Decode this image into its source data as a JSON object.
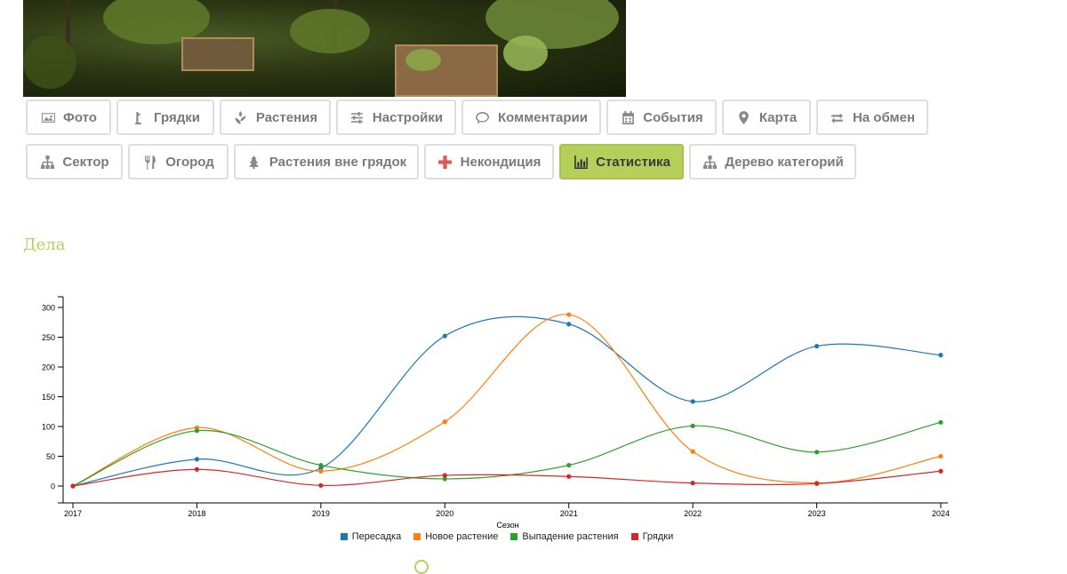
{
  "photo": {
    "alt": "garden beds photo"
  },
  "nav": {
    "row1": [
      {
        "label": "Фото",
        "icon": "image-icon"
      },
      {
        "label": "Грядки",
        "icon": "flag-icon"
      },
      {
        "label": "Растения",
        "icon": "plant-icon"
      },
      {
        "label": "Настройки",
        "icon": "sliders-icon"
      },
      {
        "label": "Комментарии",
        "icon": "comment-icon"
      },
      {
        "label": "События",
        "icon": "calendar-icon"
      },
      {
        "label": "Карта",
        "icon": "map-marker-icon"
      },
      {
        "label": "На обмен",
        "icon": "exchange-icon"
      }
    ],
    "row2": [
      {
        "label": "Сектор",
        "icon": "sitemap-icon"
      },
      {
        "label": "Огород",
        "icon": "cutlery-icon"
      },
      {
        "label": "Растения вне грядок",
        "icon": "tree-icon"
      },
      {
        "label": "Некондиция",
        "icon": "plus-icon"
      },
      {
        "label": "Статистика",
        "icon": "bar-chart-icon",
        "active": true
      },
      {
        "label": "Дерево категорий",
        "icon": "sitemap-icon"
      }
    ],
    "active_color": "#b5cf5a"
  },
  "section": {
    "title": "Дела"
  },
  "chart_data": {
    "type": "line",
    "x": [
      "2017",
      "2018",
      "2019",
      "2020",
      "2021",
      "2022",
      "2023",
      "2024"
    ],
    "xlabel": "Сезон",
    "ylabel": "",
    "ylim": [
      0,
      300
    ],
    "yticks": [
      0,
      50,
      100,
      150,
      200,
      250,
      300
    ],
    "series": [
      {
        "name": "Пересадка",
        "color": "#1f77b4",
        "values": [
          0,
          45,
          30,
          252,
          272,
          142,
          235,
          220
        ]
      },
      {
        "name": "Новое растение",
        "color": "#ff7f0e",
        "values": [
          0,
          98,
          25,
          108,
          288,
          58,
          5,
          50
        ]
      },
      {
        "name": "Выпадение растения",
        "color": "#2ca02c",
        "values": [
          0,
          93,
          35,
          12,
          35,
          101,
          57,
          107
        ]
      },
      {
        "name": "Грядки",
        "color": "#d62728",
        "values": [
          0,
          28,
          1,
          18,
          16,
          5,
          4,
          25
        ]
      }
    ],
    "legend": "bottom"
  }
}
